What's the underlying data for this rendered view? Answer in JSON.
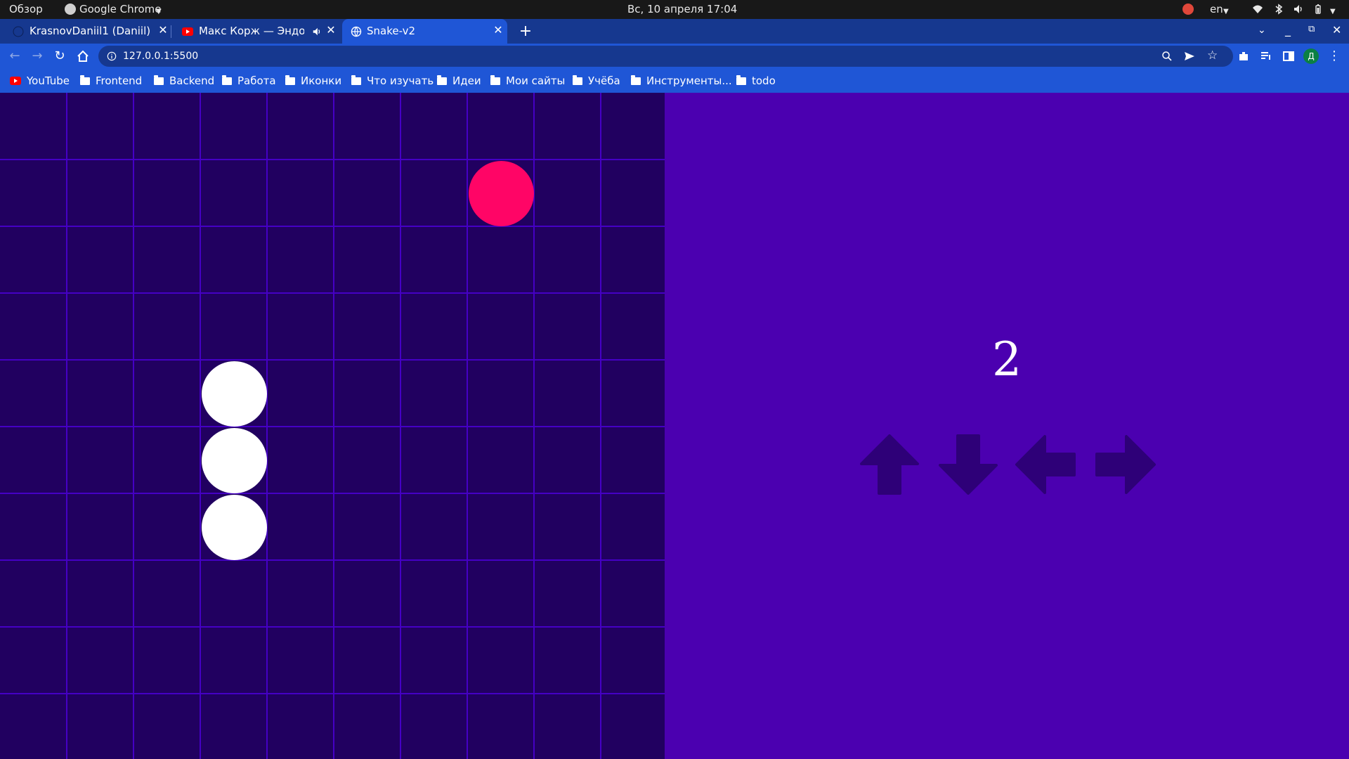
{
  "topbar": {
    "overview": "Обзор",
    "app_name": "Google Chrome",
    "clock": "Вс, 10 апреля  17:04",
    "lang": "en"
  },
  "tabs": [
    {
      "title": "KrasnovDaniil1 (Daniil)",
      "icon": "github-icon",
      "active": false
    },
    {
      "title": "Макс Корж — Эндорф",
      "icon": "youtube-icon",
      "active": false,
      "audio": true
    },
    {
      "title": "Snake-v2",
      "icon": "globe-icon",
      "active": true
    }
  ],
  "address_bar": {
    "url": "127.0.0.1:5500"
  },
  "bookmarks": [
    {
      "label": "YouTube",
      "icon": "youtube-icon"
    },
    {
      "label": "Frontend",
      "icon": "folder-icon"
    },
    {
      "label": "Backend",
      "icon": "folder-icon"
    },
    {
      "label": "Работа",
      "icon": "folder-icon"
    },
    {
      "label": "Иконки",
      "icon": "folder-icon"
    },
    {
      "label": "Что изучать",
      "icon": "folder-icon"
    },
    {
      "label": "Идеи",
      "icon": "folder-icon"
    },
    {
      "label": "Мои сайты",
      "icon": "folder-icon"
    },
    {
      "label": "Учёба",
      "icon": "folder-icon"
    },
    {
      "label": "Инструменты...",
      "icon": "folder-icon"
    },
    {
      "label": "todo",
      "icon": "folder-icon"
    }
  ],
  "game": {
    "grid": {
      "cols": 10,
      "rows": 10
    },
    "snake": [
      {
        "col": 3,
        "row": 4
      },
      {
        "col": 3,
        "row": 5
      },
      {
        "col": 3,
        "row": 6
      }
    ],
    "food": {
      "col": 7,
      "row": 1
    },
    "score": "2",
    "controls": [
      "arrow-up-icon",
      "arrow-down-icon",
      "arrow-left-icon",
      "arrow-right-icon"
    ],
    "colors": {
      "board": "#210060",
      "grid_lines": "#4500c4",
      "panel": "#4b00b0",
      "snake": "#ffffff",
      "food": "#ff0566",
      "arrows": "#2e0078"
    }
  }
}
